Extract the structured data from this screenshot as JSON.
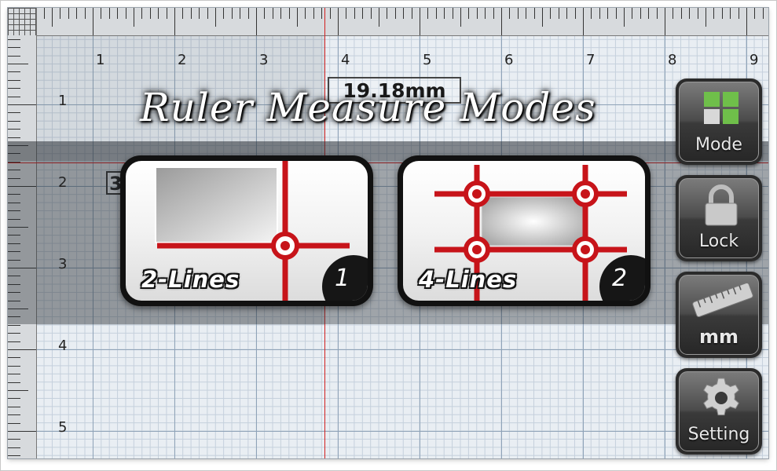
{
  "title": "Ruler Measure Modes",
  "measurement": {
    "value": "19.18mm",
    "secondary": "3"
  },
  "ruler": {
    "horizontal_labels": [
      "1",
      "2",
      "3",
      "4",
      "5",
      "6",
      "7",
      "8",
      "9"
    ],
    "vertical_labels": [
      "1",
      "2",
      "3",
      "4",
      "5"
    ]
  },
  "modes": [
    {
      "label": "2-Lines",
      "number": "1"
    },
    {
      "label": "4-Lines",
      "number": "2"
    }
  ],
  "side_buttons": [
    {
      "label": "Mode",
      "icon": "grid-icon"
    },
    {
      "label": "Lock",
      "icon": "lock-icon"
    },
    {
      "label": "mm",
      "icon": "ruler-icon"
    },
    {
      "label": "Setting",
      "icon": "gear-icon"
    }
  ],
  "colors": {
    "accent_red": "#d21f1f",
    "button_dark": "#2b2b2b",
    "mode_icon_green": "#6fbf4a"
  }
}
